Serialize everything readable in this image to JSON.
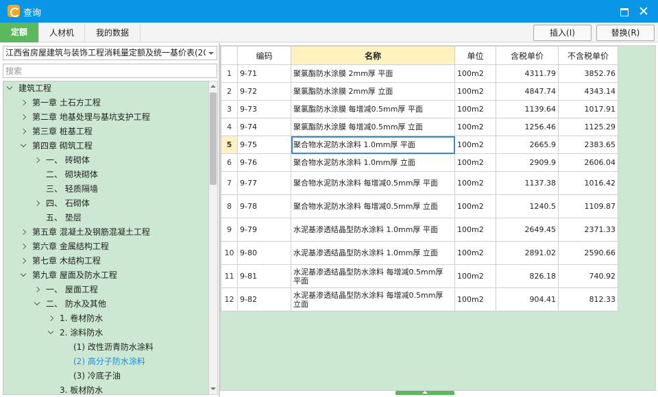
{
  "window": {
    "title": "查询"
  },
  "toolbar": {
    "tabs": [
      {
        "label": "定额"
      },
      {
        "label": "人材机"
      },
      {
        "label": "我的数据"
      }
    ],
    "insert_label": "插入(I)",
    "replace_label": "替换(R)"
  },
  "sidebar": {
    "library": "江西省房屋建筑与装饰工程消耗量定额及统一基价表(20",
    "search_placeholder": "搜索",
    "tree": [
      {
        "label": "建筑工程",
        "state": "expanded"
      },
      {
        "label": "第一章  土石方工程",
        "state": "collapsed"
      },
      {
        "label": "第二章  地基处理与基坑支护工程",
        "state": "collapsed"
      },
      {
        "label": "第三章  桩基工程",
        "state": "collapsed"
      },
      {
        "label": "第四章  砌筑工程",
        "state": "expanded"
      },
      {
        "label": "一、  砖砌体",
        "state": "collapsed"
      },
      {
        "label": "二、  砌块砌体",
        "state": "none"
      },
      {
        "label": "三、  轻质隔墙",
        "state": "none"
      },
      {
        "label": "四、  石砌体",
        "state": "collapsed"
      },
      {
        "label": "五、  垫层",
        "state": "none"
      },
      {
        "label": "第五章  混凝土及钢筋混凝土工程",
        "state": "collapsed"
      },
      {
        "label": "第六章  金属结构工程",
        "state": "collapsed"
      },
      {
        "label": "第七章  木结构工程",
        "state": "collapsed"
      },
      {
        "label": "第九章  屋面及防水工程",
        "state": "expanded"
      },
      {
        "label": "一、  屋面工程",
        "state": "collapsed"
      },
      {
        "label": "二、  防水及其他",
        "state": "expanded"
      },
      {
        "label": "1.  卷材防水",
        "state": "collapsed"
      },
      {
        "label": "2.  涂料防水",
        "state": "expanded"
      },
      {
        "label": "(1) 改性沥青防水涂料",
        "state": "none"
      },
      {
        "label": "(2) 高分子防水涂料",
        "state": "selected"
      },
      {
        "label": "(3) 冷底子油",
        "state": "none"
      },
      {
        "label": "3.  板材防水",
        "state": "none"
      }
    ]
  },
  "grid": {
    "columns": [
      "",
      "编码",
      "名称",
      "单位",
      "含税单价",
      "不含税单价"
    ],
    "rows": [
      {
        "no": "1",
        "code": "9-71",
        "name": "聚氯酯防水涂膜 2mm厚 平面",
        "unit": "100m2",
        "price_tax": "4311.79",
        "price_notax": "3852.76"
      },
      {
        "no": "2",
        "code": "9-72",
        "name": "聚氯酯防水涂膜 2mm厚 立面",
        "unit": "100m2",
        "price_tax": "4847.74",
        "price_notax": "4343.14"
      },
      {
        "no": "3",
        "code": "9-73",
        "name": "聚氯酯防水涂膜 每增减0.5mm厚 平面",
        "unit": "100m2",
        "price_tax": "1139.64",
        "price_notax": "1017.91"
      },
      {
        "no": "4",
        "code": "9-74",
        "name": "聚氯酯防水涂膜 每增减0.5mm厚 立面",
        "unit": "100m2",
        "price_tax": "1256.46",
        "price_notax": "1125.29"
      },
      {
        "no": "5",
        "code": "9-75",
        "name": "聚合物水泥防水涂料 1.0mm厚 平面",
        "unit": "100m2",
        "price_tax": "2665.9",
        "price_notax": "2383.65"
      },
      {
        "no": "6",
        "code": "9-76",
        "name": "聚合物水泥防水涂料 1.0mm厚 立面",
        "unit": "100m2",
        "price_tax": "2909.9",
        "price_notax": "2606.04"
      },
      {
        "no": "7",
        "code": "9-77",
        "name": "聚合物水泥防水涂料 每增减0.5mm厚 平面",
        "unit": "100m2",
        "price_tax": "1137.38",
        "price_notax": "1016.42"
      },
      {
        "no": "8",
        "code": "9-78",
        "name": "聚合物水泥防水涂料 每增减0.5mm厚 立面",
        "unit": "100m2",
        "price_tax": "1240.5",
        "price_notax": "1109.87"
      },
      {
        "no": "9",
        "code": "9-79",
        "name": "水泥基渗透结晶型防水涂料 1.0mm厚 平面",
        "unit": "100m2",
        "price_tax": "2649.45",
        "price_notax": "2371.33"
      },
      {
        "no": "10",
        "code": "9-80",
        "name": "水泥基渗透结晶型防水涂料 1.0mm厚 立面",
        "unit": "100m2",
        "price_tax": "2891.02",
        "price_notax": "2590.66"
      },
      {
        "no": "11",
        "code": "9-81",
        "name": "水泥基渗透结晶型防水涂料 每增减0.5mm厚 平面",
        "unit": "100m2",
        "price_tax": "826.18",
        "price_notax": "740.92"
      },
      {
        "no": "12",
        "code": "9-82",
        "name": "水泥基渗透结晶型防水涂料 每增减0.5mm厚 立面",
        "unit": "100m2",
        "price_tax": "904.41",
        "price_notax": "812.33"
      }
    ],
    "current_row": "5"
  },
  "colors": {
    "titlebar": "#0a96e6",
    "accent_green": "#5cb85c",
    "panel_green": "#cde8d2",
    "header_highlight": "#fff2bf",
    "selected_text": "#1a8fe3"
  }
}
